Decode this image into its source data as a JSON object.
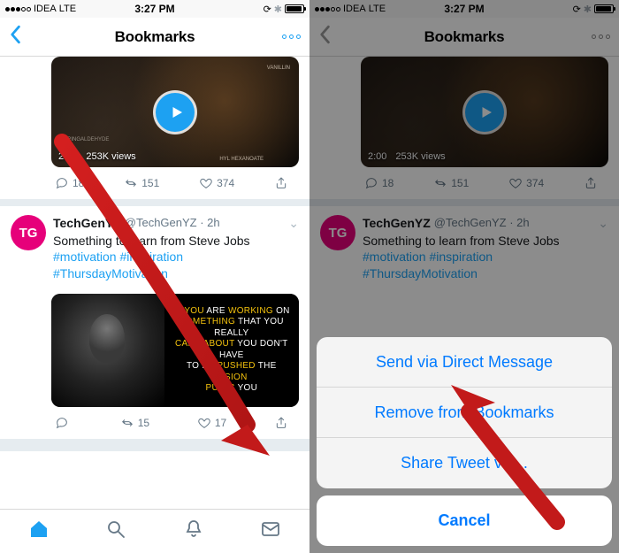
{
  "statusbar": {
    "carrier": "IDEA",
    "network": "LTE",
    "time": "3:27 PM"
  },
  "nav": {
    "title": "Bookmarks"
  },
  "tweet1": {
    "video": {
      "duration": "2:00",
      "views": "253K views"
    },
    "labels": {
      "vanillin": "VANILLIN",
      "syr": "SYRINGALDEHYDE",
      "hyl": "HYL HEXANOATE"
    },
    "actions": {
      "replies": "18",
      "retweets": "151",
      "likes": "374"
    }
  },
  "tweet2": {
    "avatar_initials": "TG",
    "display_name": "TechGenYZ",
    "handle": "@TechGenYZ",
    "time": "2h",
    "text_plain": "Something to learn from Steve Jobs ",
    "hashtags": {
      "h1": "#motivation",
      "h2": "#inspiration",
      "h3": "#ThursdayMotivation"
    },
    "quote": {
      "l1a": "IF ",
      "l1b": "YOU",
      "l1c": " ARE ",
      "l1d": "WORKING",
      "l1e": " ON",
      "l2a": "SOMETHING",
      "l2b": " THAT YOU REALLY",
      "l3a": "CARE ABOUT",
      "l3b": " YOU DON'T HAVE",
      "l4a": "TO BE ",
      "l4b": "PUSHED",
      "l4c": " THE ",
      "l4d": "VISION",
      "l5a": "PULLS",
      "l5b": " YOU"
    },
    "actions": {
      "replies": "",
      "retweets": "15",
      "likes": "17"
    }
  },
  "sheet": {
    "item1": "Send via Direct Message",
    "item2": "Remove from Bookmarks",
    "item3": "Share Tweet via...",
    "cancel": "Cancel"
  }
}
